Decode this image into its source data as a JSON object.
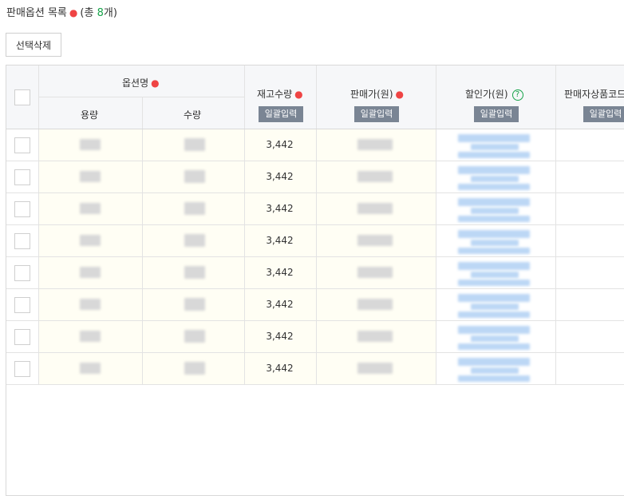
{
  "header": {
    "title": "판매옵션 목록",
    "required_marker": "●",
    "count_prefix": "(총",
    "count": "8",
    "count_suffix": "개)"
  },
  "toolbar": {
    "delete_selected_label": "선택삭제"
  },
  "table": {
    "columns": {
      "option_name": "옵션명",
      "capacity": "용량",
      "quantity": "수량",
      "stock": "재고수량",
      "price": "판매가(원)",
      "discount": "할인가(원)",
      "seller_code": "판매자상품코드"
    },
    "bulk_input_label": "일괄입력",
    "help_icon_glyph": "?",
    "rows": [
      {
        "stock": "3,442"
      },
      {
        "stock": "3,442"
      },
      {
        "stock": "3,442"
      },
      {
        "stock": "3,442"
      },
      {
        "stock": "3,442"
      },
      {
        "stock": "3,442"
      },
      {
        "stock": "3,442"
      },
      {
        "stock": "3,442"
      }
    ]
  },
  "colors": {
    "required": "#ef4444",
    "count": "#17a34a",
    "bulk_button": "#7a8594",
    "row_highlight": "#fffef4",
    "header_bg": "#f6f7f9"
  }
}
